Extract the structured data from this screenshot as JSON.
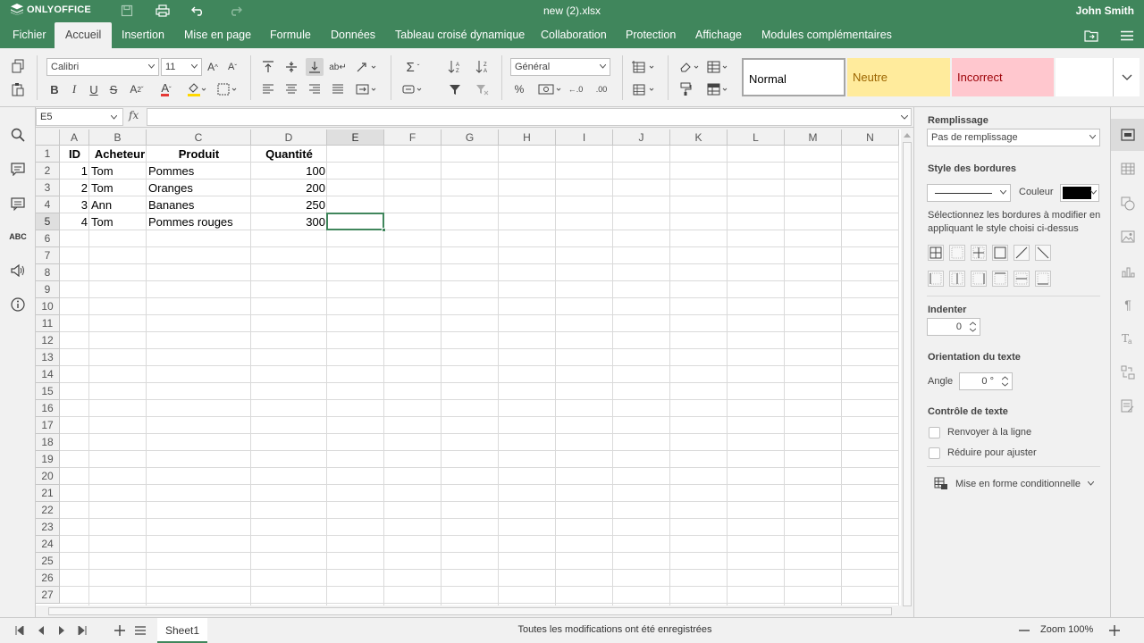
{
  "app": {
    "brand": "ONLYOFFICE",
    "doc_title": "new (2).xlsx",
    "user": "John Smith",
    "accent": "#40865c"
  },
  "menu": {
    "tabs": [
      {
        "label": "Fichier"
      },
      {
        "label": "Accueil"
      },
      {
        "label": "Insertion"
      },
      {
        "label": "Mise en page"
      },
      {
        "label": "Formule"
      },
      {
        "label": "Données"
      },
      {
        "label": "Tableau croisé dynamique"
      },
      {
        "label": "Collaboration"
      },
      {
        "label": "Protection"
      },
      {
        "label": "Affichage"
      },
      {
        "label": "Modules complémentaires"
      }
    ],
    "active": "Accueil"
  },
  "toolbar": {
    "font": "Calibri",
    "size": "11",
    "number_format": "Général",
    "styles": [
      {
        "label": "Normal",
        "bg": "#ffffff"
      },
      {
        "label": "Neutre",
        "bg": "#ffeb9c",
        "color": "#9c6500"
      },
      {
        "label": "Incorrect",
        "bg": "#ffc7ce",
        "color": "#9c0006"
      }
    ]
  },
  "formula": {
    "cell_ref": "E5",
    "fx": "fx",
    "value": ""
  },
  "sheet": {
    "columns": [
      "A",
      "B",
      "C",
      "D",
      "E",
      "F",
      "G",
      "H",
      "I",
      "J",
      "K",
      "L",
      "M",
      "N"
    ],
    "rows": [
      "1",
      "2",
      "3",
      "4",
      "5",
      "6",
      "7",
      "8",
      "9",
      "10",
      "11",
      "12",
      "13",
      "14",
      "15",
      "16",
      "17",
      "18",
      "19",
      "20",
      "21",
      "22",
      "23",
      "24",
      "25",
      "26",
      "27"
    ],
    "selected_col": "E",
    "selected_row": "5",
    "headers": [
      "ID",
      "Acheteur",
      "Produit",
      "Quantité"
    ],
    "data": [
      [
        "1",
        "Tom",
        "Pommes",
        "100"
      ],
      [
        "2",
        "Tom",
        "Oranges",
        "200"
      ],
      [
        "3",
        "Ann",
        "Bananes",
        "250"
      ],
      [
        "4",
        "Tom",
        "Pommes rouges",
        "300"
      ]
    ]
  },
  "panel": {
    "fill_title": "Remplissage",
    "fill_value": "Pas de remplissage",
    "border_title": "Style des bordures",
    "color_label": "Couleur",
    "border_color": "#000000",
    "border_hint": "Sélectionnez les bordures à modifier en appliquant le style choisi ci-dessus",
    "indent_title": "Indenter",
    "indent_value": "0",
    "orientation_title": "Orientation du texte",
    "angle_label": "Angle",
    "angle_value": "0 °",
    "text_control_title": "Contrôle de texte",
    "wrap_label": "Renvoyer à la ligne",
    "shrink_label": "Réduire pour ajuster",
    "cond_format_label": "Mise en forme conditionnelle"
  },
  "status": {
    "sheet_tab": "Sheet1",
    "message": "Toutes les modifications ont été enregistrées",
    "zoom": "Zoom 100%"
  }
}
